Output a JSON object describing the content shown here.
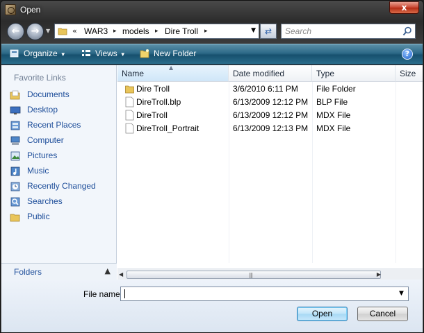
{
  "window": {
    "title": "Open",
    "close_glyph": "x"
  },
  "address": {
    "overflow_glyph": "«",
    "crumbs": [
      "WAR3",
      "models",
      "Dire Troll"
    ],
    "separator_glyph": "▸"
  },
  "search": {
    "placeholder": "Search"
  },
  "toolbar": {
    "organize": "Organize",
    "views": "Views",
    "new_folder": "New Folder",
    "help": "?"
  },
  "nav": {
    "title": "Favorite Links",
    "items": [
      {
        "label": "Documents",
        "icon": "documents-icon"
      },
      {
        "label": "Desktop",
        "icon": "desktop-icon"
      },
      {
        "label": "Recent Places",
        "icon": "recent-places-icon"
      },
      {
        "label": "Computer",
        "icon": "computer-icon"
      },
      {
        "label": "Pictures",
        "icon": "pictures-icon"
      },
      {
        "label": "Music",
        "icon": "music-icon"
      },
      {
        "label": "Recently Changed",
        "icon": "recently-changed-icon"
      },
      {
        "label": "Searches",
        "icon": "searches-icon"
      },
      {
        "label": "Public",
        "icon": "public-folder-icon"
      }
    ],
    "folders": "Folders"
  },
  "columns": {
    "name": "Name",
    "date": "Date modified",
    "type": "Type",
    "size": "Size"
  },
  "files": [
    {
      "name": "Dire Troll",
      "date": "3/6/2010 6:11 PM",
      "type": "File Folder",
      "kind": "folder"
    },
    {
      "name": "DireTroll.blp",
      "date": "6/13/2009 12:12 PM",
      "type": "BLP File",
      "kind": "file"
    },
    {
      "name": "DireTroll",
      "date": "6/13/2009 12:12 PM",
      "type": "MDX File",
      "kind": "file"
    },
    {
      "name": "DireTroll_Portrait",
      "date": "6/13/2009 12:13 PM",
      "type": "MDX File",
      "kind": "file"
    }
  ],
  "bottom": {
    "filename_label": "File name:",
    "filename_value": "",
    "open": "Open",
    "cancel": "Cancel"
  },
  "colors": {
    "toolbar": "#2d6a88",
    "link": "#1e4e9a",
    "close": "#c8432e"
  }
}
